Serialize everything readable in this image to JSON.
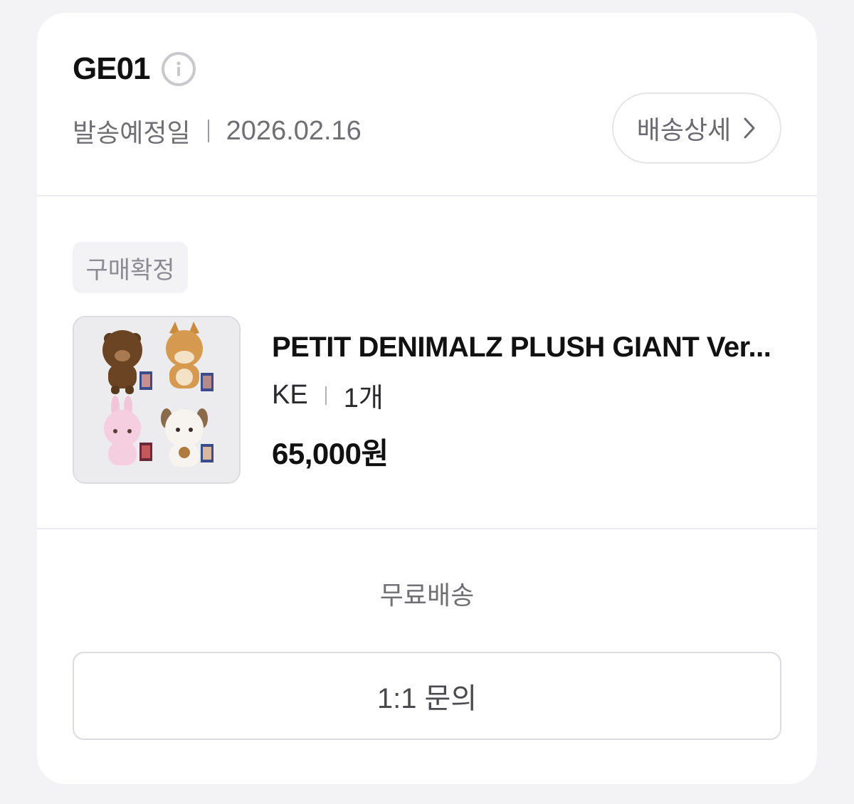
{
  "order": {
    "id": "GE01",
    "ship_label": "발송예정일",
    "ship_date": "2026.02.16",
    "detail_button": "배송상세"
  },
  "item": {
    "status": "구매확정",
    "title": "PETIT DENIMALZ PLUSH GIANT Ver...",
    "seller": "KE",
    "quantity": "1개",
    "price": "65,000원"
  },
  "footer": {
    "shipping_fee": "무료배송",
    "inquiry_button": "1:1 문의"
  },
  "colors": {
    "page_bg": "#f3f3f6",
    "card_bg": "#ffffff",
    "muted_text": "#6f6f74"
  }
}
